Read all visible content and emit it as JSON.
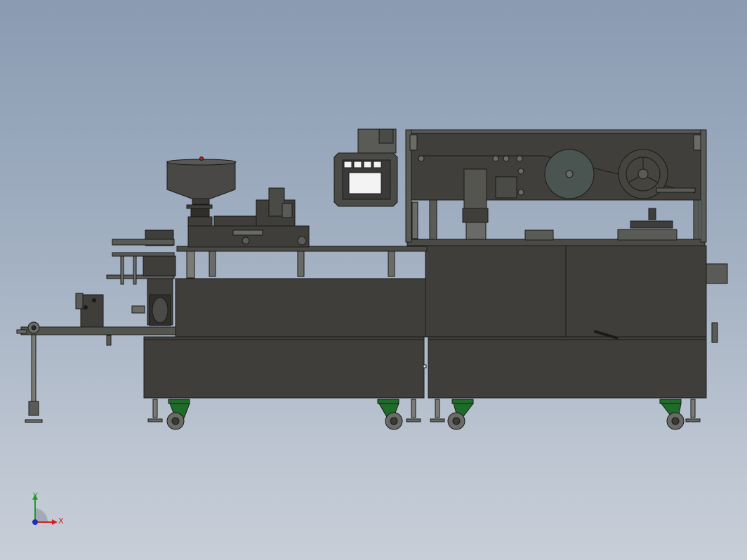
{
  "viewport": {
    "background_top": "#8a9bb2",
    "background_bottom": "#c7ced8"
  },
  "model": {
    "machine_body_color": "#3f3e3a",
    "outline_color": "#1a1a18",
    "wheel_bracket_color": "#1f6b2a",
    "foil_roll_color": "#4a5450",
    "hmi_screen_color": "#f3f3f3"
  },
  "triad": {
    "x_label": "X",
    "y_label": "Y",
    "x_color": "#d21f1f",
    "y_color": "#1f9a2a",
    "z_color": "#1f2fb8"
  }
}
